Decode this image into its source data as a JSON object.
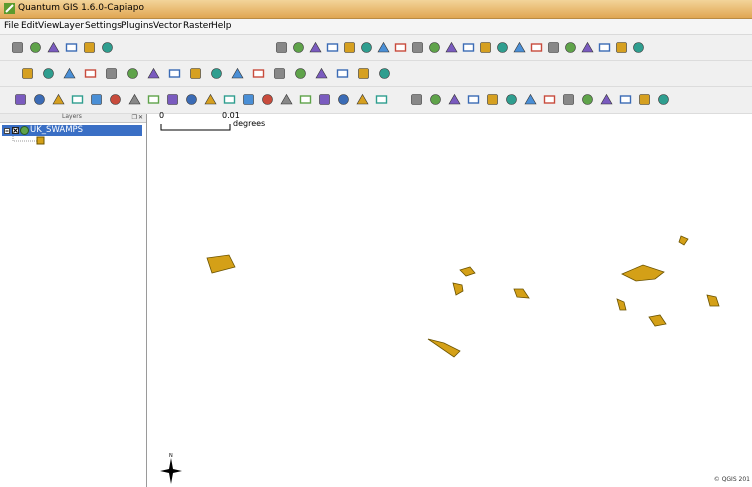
{
  "window": {
    "title": "Quantum GIS 1.6.0-Capiapo"
  },
  "menubar": {
    "items": [
      "File",
      "Edit",
      "View",
      "Layer",
      "Settings",
      "Plugins",
      "Vector",
      "Raster",
      "Help"
    ]
  },
  "layers_panel": {
    "title": "Layers",
    "buttons": "❐✕",
    "layers": [
      {
        "name": "UK_SWAMPS",
        "visible": true,
        "expanded": true,
        "fill": "#d4a017"
      }
    ]
  },
  "map": {
    "scalebar": {
      "label_start": "0",
      "label_end": "0.01",
      "units": "degrees"
    },
    "north_arrow": "N",
    "polygon_fill": "#d4a017",
    "polygon_stroke": "#6b5300",
    "copyright": "© QGIS 201"
  },
  "toolbar_icons": {
    "row1": [
      "new-project-icon",
      "open-project-icon",
      "save-project-icon",
      "save-as-icon",
      "print-composer-icon",
      "print-icon",
      "pan-icon",
      "zoom-in-icon",
      "zoom-out-icon",
      "zoom-full-icon",
      "zoom-layer-icon",
      "new-vector-icon",
      "add-vector-icon",
      "add-raster-icon",
      "add-postgis-icon",
      "add-spatialite-icon",
      "add-wms-icon",
      "add-wfs-icon",
      "identify-icon",
      "measure-icon",
      "annotation-icon",
      "select-icon",
      "tips-icon",
      "save-edits-icon",
      "add-csv-icon",
      "gps-icon",
      "grass-icon",
      "python-icon"
    ],
    "row2": [
      "plugin-icon",
      "attribute-table-icon",
      "deselect-icon",
      "table-icon",
      "calculator-icon",
      "map-tips-icon",
      "bookmark-icon",
      "new-bookmark-icon",
      "measure-line-icon",
      "select-feature-icon",
      "pan-map-icon",
      "zoom-in-map-icon",
      "zoom-out-map-icon",
      "zoom-full-map-icon",
      "zoom-selection-icon",
      "zoom-layer-map-icon",
      "zoom-last-icon",
      "refresh-icon"
    ],
    "row3": [
      "toggle-edit-icon",
      "save-layer-edits-icon",
      "move-feature-icon",
      "node-tool-icon",
      "delete-selected-icon",
      "cut-features-icon",
      "copy-features-icon",
      "paste-features-icon",
      "undo-icon",
      "redo-icon",
      "simplify-icon",
      "add-ring-icon",
      "add-part-icon",
      "delete-ring-icon",
      "delete-part-icon",
      "reshape-icon",
      "split-features-icon",
      "merge-features-icon",
      "rotate-point-icon",
      "offset-curve-icon",
      "label-icon",
      "label-move-icon",
      "label-rotate-icon",
      "label-change-icon",
      "label-pin-icon",
      "label-show-icon",
      "label-highlight-icon",
      "diagram-icon",
      "layer-properties-icon",
      "raster-info-icon",
      "vector-info-icon",
      "plugin-manager-icon",
      "georef-icon",
      "fTools-icon"
    ]
  }
}
